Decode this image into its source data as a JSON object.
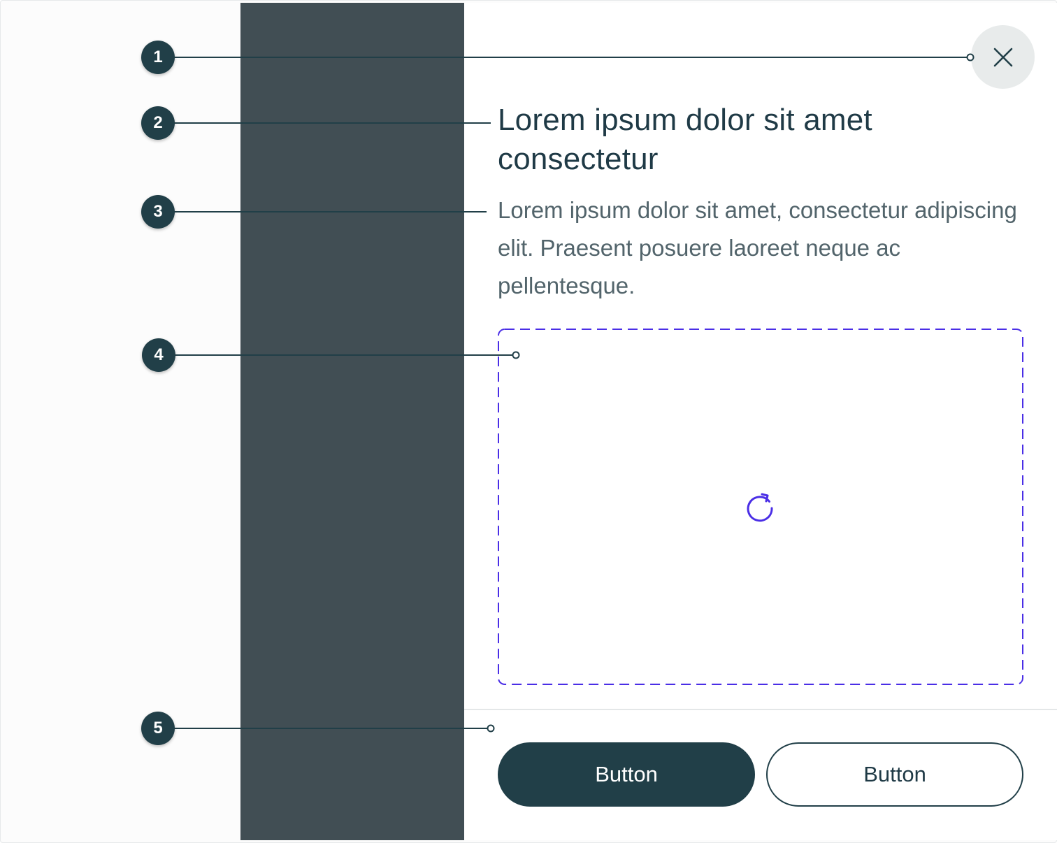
{
  "dialog": {
    "close_icon": "close-icon",
    "title": "Lorem ipsum dolor sit amet consectetur",
    "body": "Lorem ipsum dolor sit amet, consectetur adipiscing elit. Praesent posuere laoreet neque ac pellentesque.",
    "slot_icon": "refresh-icon",
    "primary_button": "Button",
    "secondary_button": "Button"
  },
  "annotations": [
    "1",
    "2",
    "3",
    "4",
    "5"
  ],
  "colors": {
    "brand_dark": "#213f48",
    "overlay": "#414e54",
    "slot_border": "#4a2ee6",
    "text_muted": "#52646b"
  }
}
